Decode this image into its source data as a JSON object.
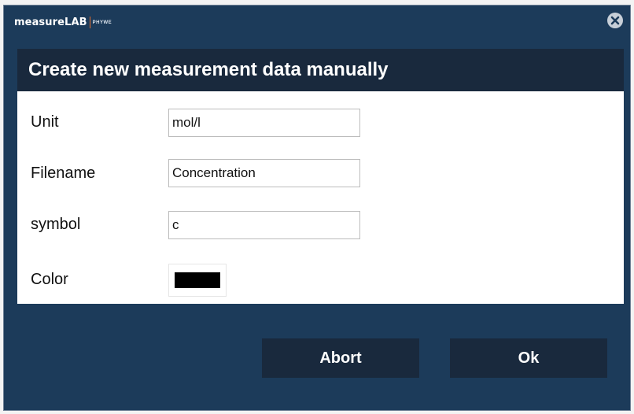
{
  "app": {
    "brand_name": "measureLAB",
    "brand_sub": "PHYWE"
  },
  "dialog": {
    "title": "Create new measurement data manually",
    "fields": [
      {
        "label": "Unit",
        "value": "mol/l"
      },
      {
        "label": "Filename",
        "value": "Concentration"
      },
      {
        "label": "symbol",
        "value": "c"
      }
    ],
    "color": {
      "label": "Color",
      "value": "#000000"
    }
  },
  "buttons": {
    "abort_label": "Abort",
    "ok_label": "Ok"
  },
  "colors": {
    "window_bg": "#1c3b5a",
    "header_bg": "#19293d",
    "accent": "#e46c2c"
  }
}
